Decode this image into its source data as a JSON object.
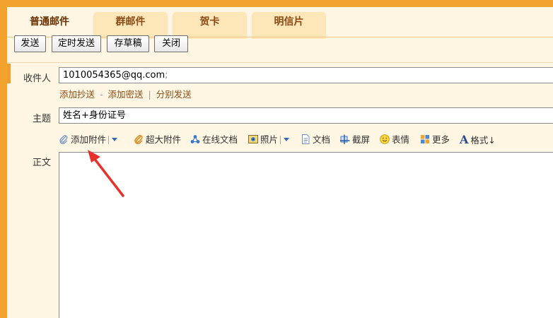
{
  "tabs": [
    {
      "label": "普通邮件",
      "active": true
    },
    {
      "label": "群邮件",
      "active": false
    },
    {
      "label": "贺卡",
      "active": false
    },
    {
      "label": "明信片",
      "active": false
    }
  ],
  "toolbar": {
    "send": "发送",
    "scheduled_send": "定时发送",
    "save_draft": "存草稿",
    "close": "关闭"
  },
  "recipient": {
    "label": "收件人",
    "value": "1010054365@qq.com",
    "separator": ";"
  },
  "recipient_links": {
    "add_cc": "添加抄送",
    "add_bcc": "添加密送",
    "separate_send": "分别发送",
    "dot": "-",
    "bar": "|"
  },
  "subject": {
    "label": "主题",
    "value": "姓名+身份证号"
  },
  "attach_bar": {
    "add_attachment": "添加附件",
    "large_attachment": "超大附件",
    "online_doc": "在线文档",
    "photo": "照片",
    "document": "文档",
    "screenshot": "截屏",
    "emoji": "表情",
    "more": "更多",
    "format": "格式↓"
  },
  "body": {
    "label": "正文"
  },
  "colors": {
    "accent_orange": "#f3a42e",
    "panel_bg": "#fff7e4",
    "tab_bg": "#fde6b8",
    "link_brown": "#8a4a13",
    "annotation_arrow": "#e8312a"
  }
}
